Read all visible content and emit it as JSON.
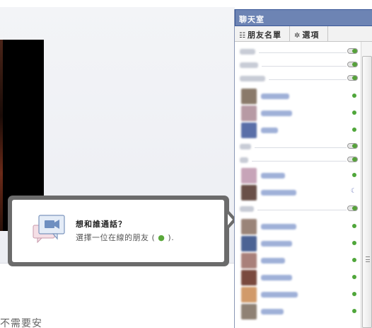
{
  "popup": {
    "title": "想和誰通話？",
    "subtitle_prefix": "選擇一位在線的朋友 (",
    "subtitle_dot": "●",
    "subtitle_suffix": ")."
  },
  "footer": {
    "text": "不需要安"
  },
  "chat": {
    "title": "聊天室",
    "tabs": {
      "friends": "朋友名單",
      "options": "選項"
    },
    "icons": {
      "friends_tab": "list-icon",
      "options_tab": "gear-icon"
    },
    "colors": {
      "header_bg": "#6d84b4",
      "online": "#4fa63a",
      "idle": "#7a86c5"
    },
    "rows": [
      {
        "kind": "group",
        "toggle": "on"
      },
      {
        "kind": "group",
        "toggle": "on"
      },
      {
        "kind": "group",
        "toggle": "on"
      },
      {
        "kind": "friend",
        "status": "online",
        "avatar": "#8a7a6a"
      },
      {
        "kind": "friend",
        "status": "online",
        "avatar": "#b79aa4"
      },
      {
        "kind": "friend",
        "status": "online",
        "avatar": "#5a6fa8"
      },
      {
        "kind": "group",
        "toggle": "on"
      },
      {
        "kind": "group",
        "toggle": "on"
      },
      {
        "kind": "friend",
        "status": "online",
        "avatar": "#c7a4b8"
      },
      {
        "kind": "friend",
        "status": "idle",
        "avatar": "#6a5048"
      },
      {
        "kind": "group",
        "toggle": "on"
      },
      {
        "kind": "friend",
        "status": "online",
        "avatar": "#9a8478"
      },
      {
        "kind": "friend",
        "status": "online",
        "avatar": "#4c6394"
      },
      {
        "kind": "friend",
        "status": "online",
        "avatar": "#a9807a"
      },
      {
        "kind": "friend",
        "status": "online",
        "avatar": "#7a4a3e"
      },
      {
        "kind": "friend",
        "status": "online",
        "avatar": "#d19a6a"
      },
      {
        "kind": "friend",
        "status": "online",
        "avatar": "#8f8174"
      }
    ]
  }
}
